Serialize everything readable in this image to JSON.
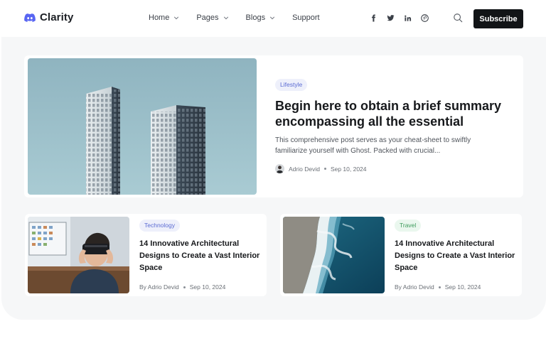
{
  "brand": {
    "name": "Clarity",
    "logo_icon": "discord-icon"
  },
  "nav": {
    "items": [
      {
        "label": "Home",
        "has_dropdown": true
      },
      {
        "label": "Pages",
        "has_dropdown": true
      },
      {
        "label": "Blogs",
        "has_dropdown": true
      },
      {
        "label": "Support",
        "has_dropdown": false
      }
    ]
  },
  "socials": [
    "facebook-icon",
    "twitter-icon",
    "linkedin-icon",
    "pinterest-icon"
  ],
  "header": {
    "search_icon": "search-icon",
    "subscribe_label": "Subscribe"
  },
  "featured": {
    "tag": "Lifestyle",
    "title": "Begin here to obtain a brief summary encompassing all the essential",
    "excerpt": "This comprehensive post serves as your cheat-sheet to swiftly familiarize yourself with Ghost. Packed with crucial...",
    "author": "Adrio Devid",
    "date": "Sep 10, 2024"
  },
  "posts": [
    {
      "tag": "Technology",
      "title": "14 Innovative Architectural Designs to Create a Vast Interior Space",
      "author": "By Adrio Devid",
      "date": "Sep 10, 2024"
    },
    {
      "tag": "Travel",
      "title": "14 Innovative Architectural Designs to Create a Vast Interior Space",
      "author": "By Adrio Devid",
      "date": "Sep 10, 2024"
    }
  ],
  "colors": {
    "accent_dark": "#121417",
    "tag_blue_bg": "#eef0fb",
    "tag_blue_text": "#5b6bd3",
    "tag_green_bg": "#eaf7ee",
    "tag_green_text": "#3e9b5c",
    "page_bg": "#f6f7f8"
  }
}
